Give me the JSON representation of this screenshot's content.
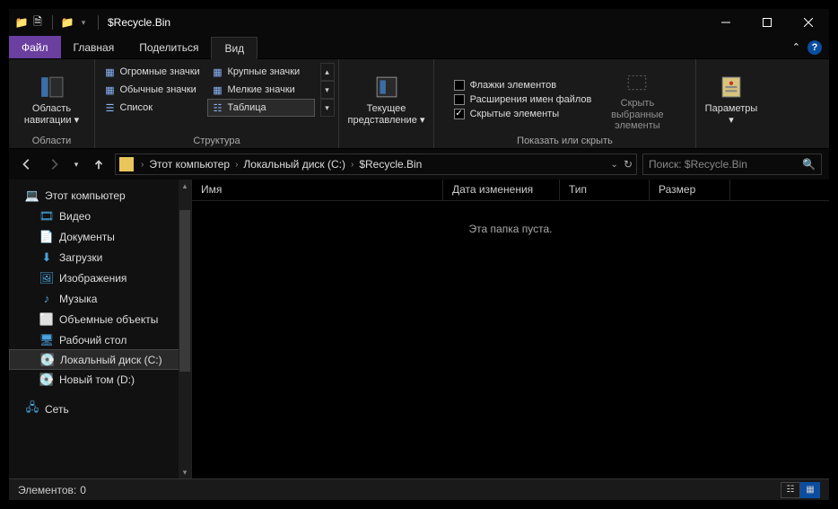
{
  "title": "$Recycle.Bin",
  "tabs": {
    "file": "Файл",
    "home": "Главная",
    "share": "Поделиться",
    "view": "Вид"
  },
  "ribbon": {
    "g_panes": "Области",
    "nav_pane": "Область навигации",
    "g_layout": "Структура",
    "layouts": {
      "xlarge": "Огромные значки",
      "large": "Крупные значки",
      "medium": "Обычные значки",
      "small": "Мелкие значки",
      "list": "Список",
      "details": "Таблица"
    },
    "g_curview": "Текущее представление",
    "curview": "Текущее представление",
    "g_showhide": "Показать или скрыть",
    "chk_boxes": "Флажки элементов",
    "chk_ext": "Расширения имен файлов",
    "chk_hidden": "Скрытые элементы",
    "hide_selected": "Скрыть выбранные элементы",
    "options": "Параметры"
  },
  "breadcrumb": {
    "pc": "Этот компьютер",
    "drive": "Локальный диск (C:)",
    "folder": "$Recycle.Bin"
  },
  "search_placeholder": "Поиск: $Recycle.Bin",
  "tree": {
    "pc": "Этот компьютер",
    "videos": "Видео",
    "documents": "Документы",
    "downloads": "Загрузки",
    "pictures": "Изображения",
    "music": "Музыка",
    "objects3d": "Объемные объекты",
    "desktop": "Рабочий стол",
    "drive_c": "Локальный диск (C:)",
    "drive_d": "Новый том (D:)",
    "network": "Сеть"
  },
  "columns": {
    "name": "Имя",
    "date": "Дата изменения",
    "type": "Тип",
    "size": "Размер"
  },
  "empty_text": "Эта папка пуста.",
  "status": {
    "items_label": "Элементов:",
    "items_count": "0"
  }
}
